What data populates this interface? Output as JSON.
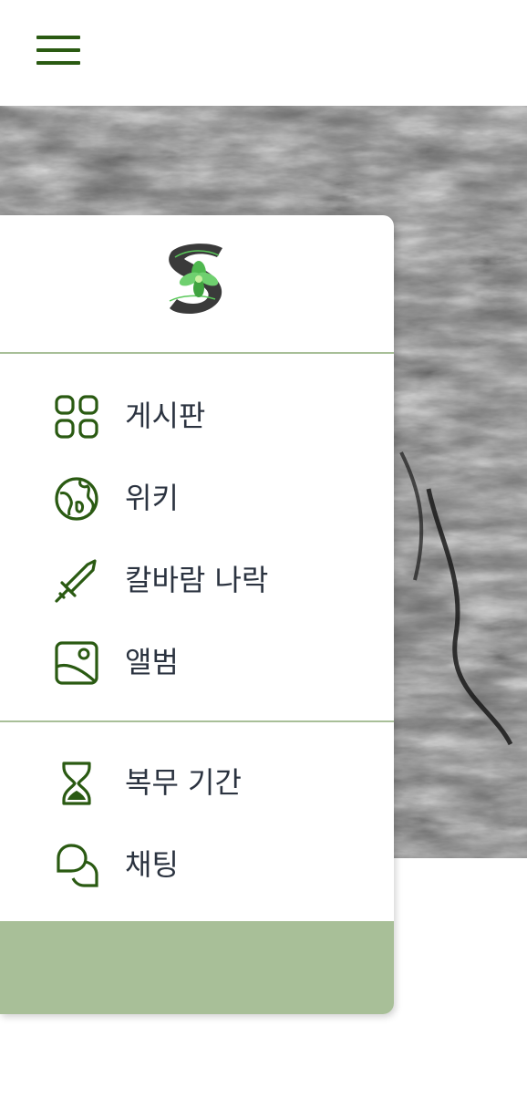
{
  "header": {
    "menu_icon": "hamburger-menu-icon"
  },
  "hero": {
    "image": "tree-bark-texture"
  },
  "drawer": {
    "logo": "leaf-s-logo",
    "primary_items": [
      {
        "label": "게시판",
        "icon": "grid-icon"
      },
      {
        "label": "위키",
        "icon": "globe-icon"
      },
      {
        "label": "칼바람 나락",
        "icon": "sword-icon"
      },
      {
        "label": "앨범",
        "icon": "image-icon"
      }
    ],
    "secondary_items": [
      {
        "label": "복무 기간",
        "icon": "hourglass-icon"
      },
      {
        "label": "채팅",
        "icon": "chat-bubbles-icon"
      }
    ]
  },
  "colors": {
    "accent": "#2a5a12",
    "divider": "#a8bf98",
    "footer": "#a8bf98",
    "text": "#2b3340"
  }
}
